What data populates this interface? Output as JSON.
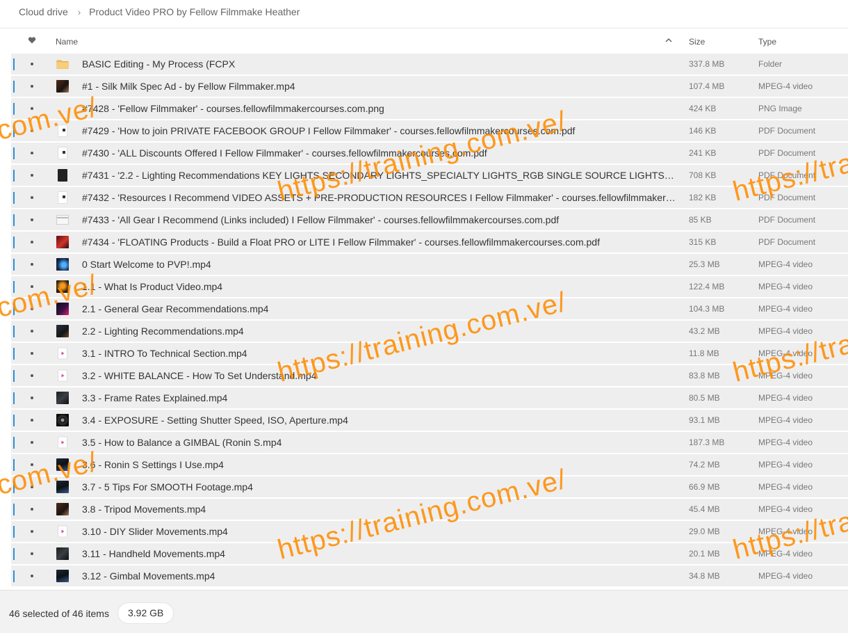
{
  "breadcrumb": {
    "root": "Cloud drive",
    "current": "Product Video PRO by Fellow Filmmake Heather"
  },
  "header": {
    "name": "Name",
    "size": "Size",
    "type": "Type"
  },
  "files": [
    {
      "name": "BASIC Editing - My Process (FCPX",
      "size": "337.8 MB",
      "type": "Folder",
      "icon": "folder"
    },
    {
      "name": "#1 - Silk Milk Spec Ad - by Fellow Filmmaker.mp4",
      "size": "107.4 MB",
      "type": "MPEG-4 video",
      "icon": "thumb-dark1"
    },
    {
      "name": "#7428 - 'Fellow Filmmaker' - courses.fellowfilmmakercourses.com.png",
      "size": "424 KB",
      "type": "PNG Image",
      "icon": "thumb-blank"
    },
    {
      "name": "#7429 - 'How to join PRIVATE FACEBOOK GROUP I Fellow Filmmaker' - courses.fellowfilmmakercourses.com.pdf",
      "size": "146 KB",
      "type": "PDF Document",
      "icon": "thumb-pdfwhite"
    },
    {
      "name": "#7430 - 'ALL Discounts Offered I Fellow Filmmaker' - courses.fellowfilmmakercourses.com.pdf",
      "size": "241 KB",
      "type": "PDF Document",
      "icon": "thumb-pdfwhite"
    },
    {
      "name": "#7431 - '2.2 - Lighting Recommendations KEY LIGHTS SECONDARY LIGHTS_SPECIALTY LIGHTS_RGB SINGLE SOURCE LIGHTS_ I Fellow Filmmaker' - courses.fellowfilmmakercourses.com.pdf",
      "size": "708 KB",
      "type": "PDF Document",
      "icon": "thumb-pdfblk"
    },
    {
      "name": "#7432 - 'Resources I Recommend VIDEO ASSETS + PRE-PRODUCTION RESOURCES I Fellow Filmmaker' - courses.fellowfilmmakercourses.com.pdf",
      "size": "182 KB",
      "type": "PDF Document",
      "icon": "thumb-pdfwhite"
    },
    {
      "name": "#7433 - 'All Gear I Recommend (Links included) I Fellow Filmmaker' - courses.fellowfilmmakercourses.com.pdf",
      "size": "85 KB",
      "type": "PDF Document",
      "icon": "thumb-gray"
    },
    {
      "name": "#7434 - 'FLOATING Products - Build a Float PRO or LITE I Fellow Filmmaker' - courses.fellowfilmmakercourses.com.pdf",
      "size": "315 KB",
      "type": "PDF Document",
      "icon": "thumb-red"
    },
    {
      "name": "0 Start Welcome to PVP!.mp4",
      "size": "25.3 MB",
      "type": "MPEG-4 video",
      "icon": "thumb-blue"
    },
    {
      "name": "1.1 - What Is Product Video.mp4",
      "size": "122.4 MB",
      "type": "MPEG-4 video",
      "icon": "thumb-orange"
    },
    {
      "name": "2.1 - General Gear Recommendations.mp4",
      "size": "104.3 MB",
      "type": "MPEG-4 video",
      "icon": "thumb-mag"
    },
    {
      "name": "2.2 - Lighting Recommendations.mp4",
      "size": "43.2 MB",
      "type": "MPEG-4 video",
      "icon": "thumb-dark3"
    },
    {
      "name": "3.1 - INTRO To Technical Section.mp4",
      "size": "11.8 MB",
      "type": "MPEG-4 video",
      "icon": "video"
    },
    {
      "name": "3.2 - WHITE BALANCE - How To Set Understand.mp4",
      "size": "83.8 MB",
      "type": "MPEG-4 video",
      "icon": "video"
    },
    {
      "name": "3.3 - Frame Rates Explained.mp4",
      "size": "80.5 MB",
      "type": "MPEG-4 video",
      "icon": "thumb-dark4"
    },
    {
      "name": "3.4 - EXPOSURE - Setting Shutter Speed, ISO, Aperture.mp4",
      "size": "93.1 MB",
      "type": "MPEG-4 video",
      "icon": "thumb-cam"
    },
    {
      "name": "3.5 - How to Balance a GIMBAL (Ronin S.mp4",
      "size": "187.3 MB",
      "type": "MPEG-4 video",
      "icon": "video"
    },
    {
      "name": "3.6 - Ronin S Settings I Use.mp4",
      "size": "74.2 MB",
      "type": "MPEG-4 video",
      "icon": "thumb-dark2"
    },
    {
      "name": "3.7 - 5 Tips For SMOOTH Footage.mp4",
      "size": "66.9 MB",
      "type": "MPEG-4 video",
      "icon": "thumb-dark2"
    },
    {
      "name": "3.8 - Tripod Movements.mp4",
      "size": "45.4 MB",
      "type": "MPEG-4 video",
      "icon": "thumb-dark1"
    },
    {
      "name": "3.10 - DIY Slider Movements.mp4",
      "size": "29.0 MB",
      "type": "MPEG-4 video",
      "icon": "video"
    },
    {
      "name": "3.11 - Handheld Movements.mp4",
      "size": "20.1 MB",
      "type": "MPEG-4 video",
      "icon": "thumb-dark4"
    },
    {
      "name": "3.12 - Gimbal Movements.mp4",
      "size": "34.8 MB",
      "type": "MPEG-4 video",
      "icon": "thumb-dark2"
    }
  ],
  "footer": {
    "selection": "46 selected of 46 items",
    "total_size": "3.92 GB"
  },
  "watermark": {
    "text": "https://training.com.ve/",
    "color": "#ff8c00"
  },
  "colors": {
    "selection_mark": "#2e8ed8",
    "row_bg": "#eeeeee"
  }
}
